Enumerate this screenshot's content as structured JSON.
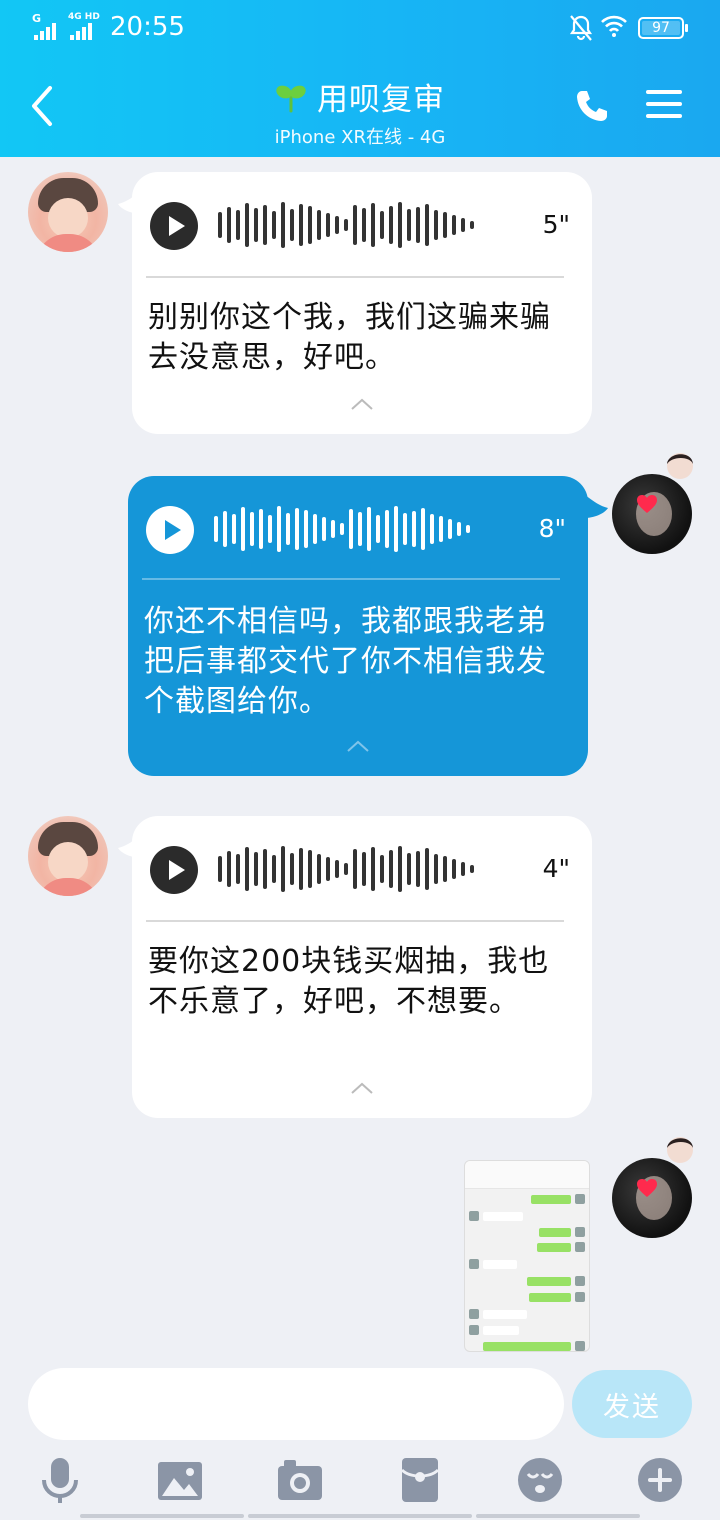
{
  "status_bar": {
    "signal_1_label": "G",
    "signal_2_label": "4G HD",
    "time": "20:55",
    "battery": "97"
  },
  "header": {
    "title": "用呗复审",
    "subtitle": "iPhone XR在线 - 4G"
  },
  "messages": [
    {
      "direction": "incoming",
      "type": "voice",
      "duration": "5\"",
      "transcript": "别别你这个我，我们这骗来骗去没意思，好吧。"
    },
    {
      "direction": "outgoing",
      "type": "voice",
      "duration": "8\"",
      "transcript": "你还不相信吗，我都跟我老弟把后事都交代了你不相信我发个截图给你。"
    },
    {
      "direction": "incoming",
      "type": "voice",
      "duration": "4\"",
      "transcript": "要你这200块钱买烟抽，我也不乐意了，好吧，不想要。"
    },
    {
      "direction": "outgoing",
      "type": "image",
      "image_label": "chat-screenshot"
    }
  ],
  "composer": {
    "input_value": "",
    "send_label": "发送"
  },
  "toolbar": [
    "microphone-icon",
    "image-icon",
    "camera-icon",
    "red-packet-icon",
    "emoji-icon",
    "plus-icon"
  ],
  "colors": {
    "header": "#17b5f5",
    "outgoing_bubble": "#1596d8",
    "incoming_bubble": "#ffffff",
    "background": "#eef0f5",
    "send_button": "#b8e6f8",
    "toolbar_icon": "#8b95a6"
  }
}
